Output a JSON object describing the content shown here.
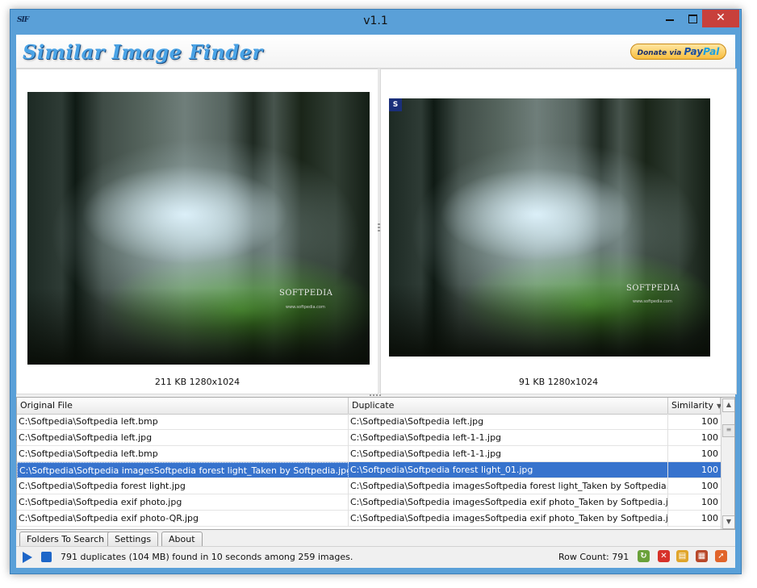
{
  "window": {
    "title": "v1.1",
    "app_icon_text": "SIF",
    "controls": {
      "minimize": "minimize",
      "maximize": "maximize",
      "close": "✕"
    }
  },
  "banner": {
    "logo_text": "Similar Image Finder",
    "donate": {
      "prefix": "Donate via",
      "brand_a": "Pay",
      "brand_b": "Pal"
    }
  },
  "preview": {
    "left": {
      "caption": "211 KB 1280x1024",
      "watermark": "SOFTPEDIA",
      "watermark_sub": "www.softpedia.com"
    },
    "right": {
      "caption": "91 KB 1280x1024",
      "watermark": "SOFTPEDIA",
      "watermark_sub": "www.softpedia.com",
      "tag": "S"
    }
  },
  "grid": {
    "columns": [
      "Original File",
      "Duplicate",
      "Similarity"
    ],
    "rows": [
      {
        "original": "C:\\Softpedia\\Softpedia left.bmp",
        "duplicate": "C:\\Softpedia\\Softpedia left.jpg",
        "similarity": "100"
      },
      {
        "original": "C:\\Softpedia\\Softpedia left.jpg",
        "duplicate": "C:\\Softpedia\\Softpedia left-1-1.jpg",
        "similarity": "100"
      },
      {
        "original": "C:\\Softpedia\\Softpedia left.bmp",
        "duplicate": "C:\\Softpedia\\Softpedia left-1-1.jpg",
        "similarity": "100"
      },
      {
        "original": "C:\\Softpedia\\Softpedia imagesSoftpedia forest light_Taken by Softpedia.jpg",
        "duplicate": "C:\\Softpedia\\Softpedia forest light_01.jpg",
        "similarity": "100",
        "selected": true
      },
      {
        "original": "C:\\Softpedia\\Softpedia forest light.jpg",
        "duplicate": "C:\\Softpedia\\Softpedia imagesSoftpedia forest light_Taken by Softpedia.jpg",
        "similarity": "100"
      },
      {
        "original": "C:\\Softpedia\\Softpedia exif photo.jpg",
        "duplicate": "C:\\Softpedia\\Softpedia imagesSoftpedia exif photo_Taken by Softpedia.jpg",
        "similarity": "100"
      },
      {
        "original": "C:\\Softpedia\\Softpedia exif photo-QR.jpg",
        "duplicate": "C:\\Softpedia\\Softpedia imagesSoftpedia exif photo_Taken by Softpedia.jpg",
        "similarity": "100"
      }
    ]
  },
  "tabs": [
    "Folders To Search",
    "Settings",
    "About"
  ],
  "status": {
    "message": "791 duplicates (104 MB) found in 10 seconds among 259 images.",
    "row_count": "Row Count: 791"
  },
  "colors": {
    "window_frame": "#5aa0d8",
    "close_button": "#c8403b",
    "selection": "#3773cd",
    "logo": "#4aa3e6"
  },
  "icons": [
    "play-icon",
    "stop-icon",
    "refresh-icon",
    "delete-icon",
    "folder-icon",
    "grid-icon",
    "export-icon"
  ]
}
